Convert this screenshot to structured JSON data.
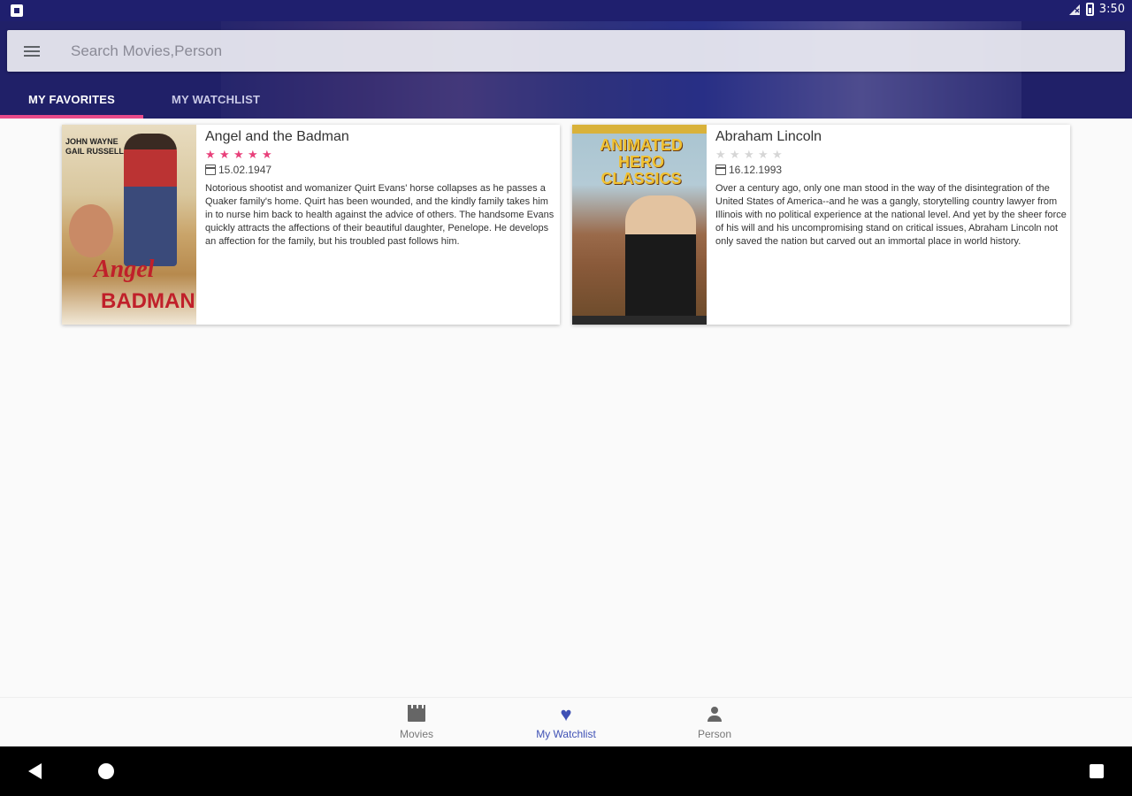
{
  "status_bar": {
    "time": "3:50"
  },
  "search": {
    "placeholder": "Search Movies,Person",
    "value": ""
  },
  "tabs": [
    {
      "label": "MY FAVORITES",
      "active": true
    },
    {
      "label": "MY WATCHLIST",
      "active": false
    }
  ],
  "movies": [
    {
      "title": "Angel and the Badman",
      "rating_stars": 5,
      "max_stars": 5,
      "date": "15.02.1947",
      "overview": "Notorious shootist and womanizer Quirt Evans' horse collapses as he passes a Quaker family's home. Quirt has been wounded, and the kindly family takes him in to nurse him back to health against the advice of others. The handsome Evans quickly attracts the affections of their beautiful daughter, Penelope. He develops an affection for the family, but his troubled past follows him.",
      "poster": {
        "top_text": "JOHN WAYNE\nGAIL RUSSELL",
        "title_line1": "Angel",
        "title_line2": "BADMAN"
      }
    },
    {
      "title": "Abraham Lincoln",
      "rating_stars": 0,
      "max_stars": 5,
      "date": "16.12.1993",
      "overview": "Over a century ago, only one man stood in the way of the disintegration of the United States of America--and he was a gangly, storytelling country lawyer from Illinois with no political experience at the national level. And yet by the sheer force of his will and his uncompromising stand on critical issues, Abraham Lincoln not only saved the nation but carved out an immortal place in world history.",
      "poster": {
        "title": "ANIMATED HERO CLASSICS"
      }
    }
  ],
  "bottom_nav": [
    {
      "label": "Movies",
      "icon": "movie-clapper-icon",
      "active": false
    },
    {
      "label": "My Watchlist",
      "icon": "heart-icon",
      "active": true
    },
    {
      "label": "Person",
      "icon": "person-icon",
      "active": false
    }
  ],
  "colors": {
    "primary": "#22236b",
    "accent": "#e8407a",
    "nav_active": "#3f51b5"
  }
}
